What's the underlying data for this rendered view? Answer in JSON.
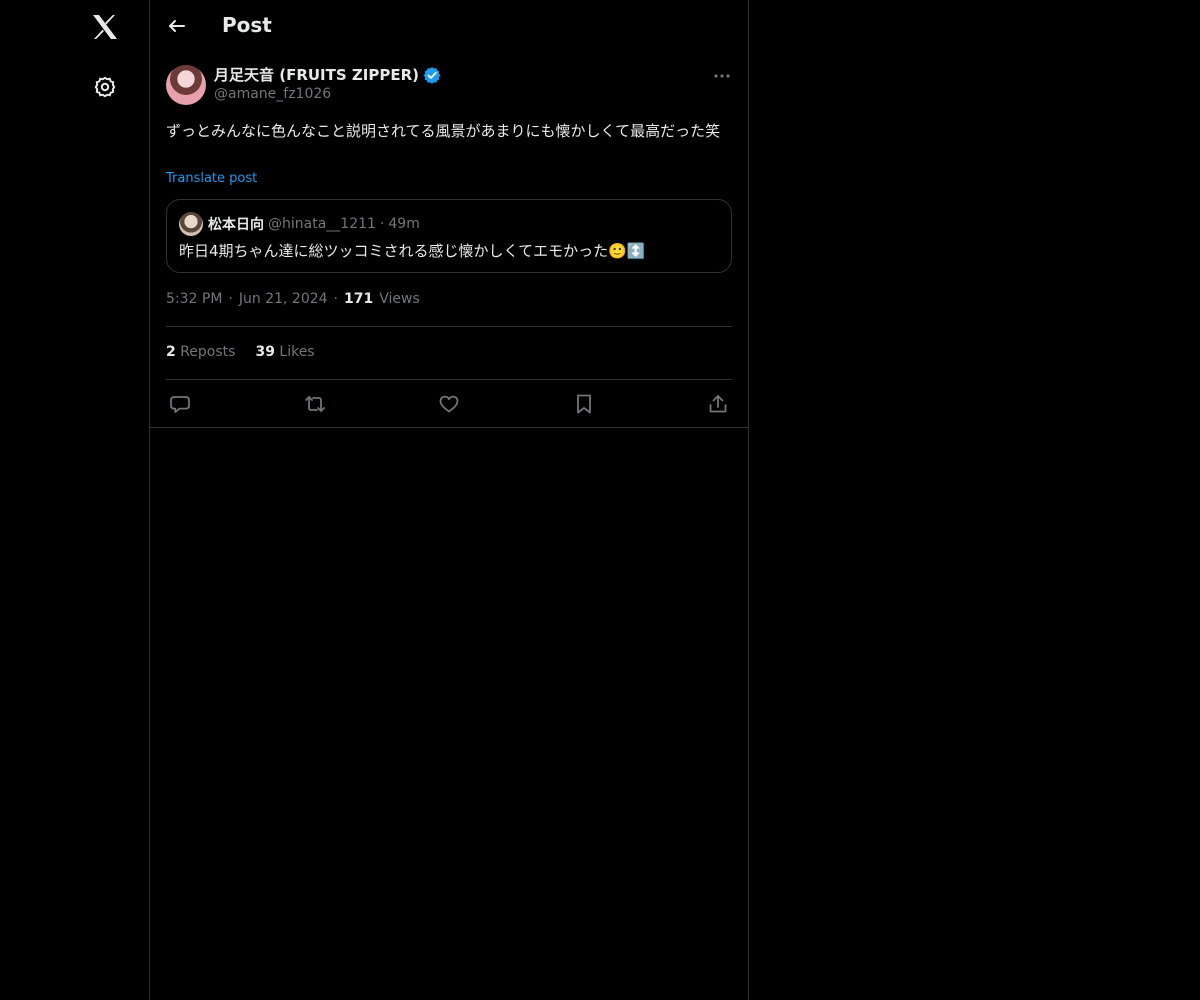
{
  "header": {
    "title": "Post"
  },
  "author": {
    "name": "月足天音 (FRUITS ZIPPER)",
    "handle": "@amane_fz1026"
  },
  "post": {
    "text": "ずっとみんなに色んなこと説明されてる風景があまりにも懐かしくて最高だった笑",
    "translate_label": "Translate post"
  },
  "quote": {
    "name": "松本日向",
    "handle": "@hinata__1211",
    "separator": "·",
    "time": "49m",
    "text": "昨日4期ちゃん達に総ツッコミされる感じ懐かしくてエモかった🙂↕️"
  },
  "meta": {
    "time": "5:32 PM",
    "separator": "·",
    "date": "Jun 21, 2024",
    "views_count": "171",
    "views_label": "Views"
  },
  "stats": {
    "reposts_count": "2",
    "reposts_label": "Reposts",
    "likes_count": "39",
    "likes_label": "Likes"
  },
  "icons": {
    "logo": "x-logo-icon",
    "settings": "gear-icon",
    "back": "arrow-left-icon",
    "more": "more-horizontal-icon",
    "verified": "verified-badge-icon",
    "reply": "reply-icon",
    "repost": "repost-icon",
    "like": "heart-icon",
    "bookmark": "bookmark-icon",
    "share": "share-icon"
  },
  "colors": {
    "background": "#000000",
    "text": "#e7e9ea",
    "muted": "#71767b",
    "accent": "#1d9bf0",
    "border": "#2f3336"
  }
}
